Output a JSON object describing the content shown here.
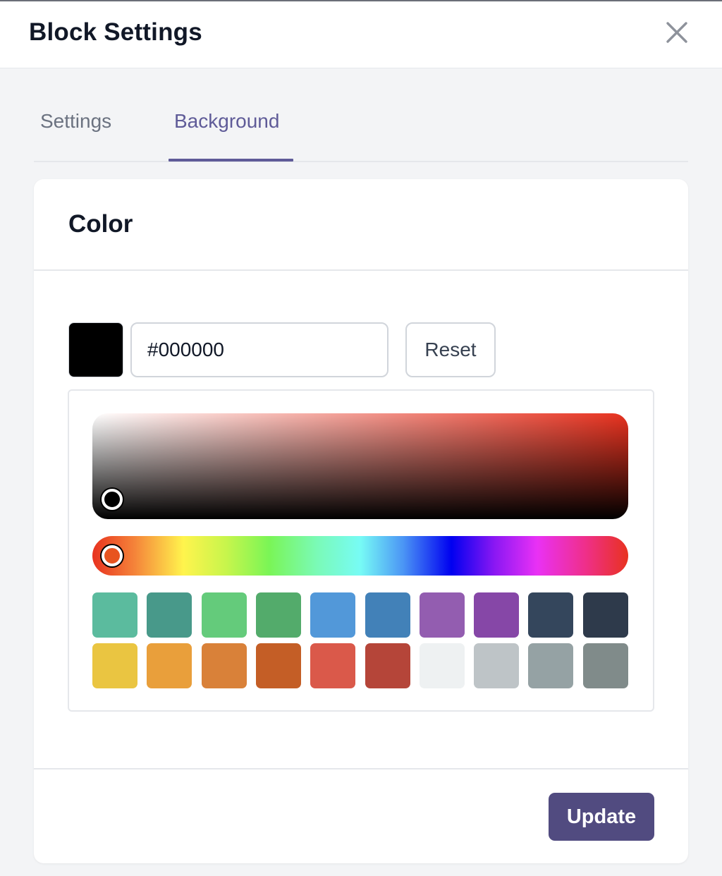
{
  "header": {
    "title": "Block Settings",
    "close_icon": "close-icon"
  },
  "tabs": [
    {
      "label": "Settings",
      "active": false
    },
    {
      "label": "Background",
      "active": true
    }
  ],
  "card": {
    "title": "Color",
    "color_input": {
      "value": "#000000",
      "current_color": "#000000"
    },
    "reset_label": "Reset",
    "picker": {
      "hue_color": "#e8321f"
    },
    "palette": [
      "#5bbb9e",
      "#48998a",
      "#64cb7b",
      "#53ab6b",
      "#5298d9",
      "#4281b8",
      "#935db0",
      "#8647a7",
      "#34465c",
      "#2e3a4b",
      "#eac541",
      "#e99f3b",
      "#d98139",
      "#c45e26",
      "#da594a",
      "#b54539",
      "#eef1f2",
      "#bec4c7",
      "#95a2a4",
      "#808b8a"
    ],
    "update_label": "Update"
  },
  "colors": {
    "accent": "#5f5b98",
    "primary_button": "#514b80"
  }
}
